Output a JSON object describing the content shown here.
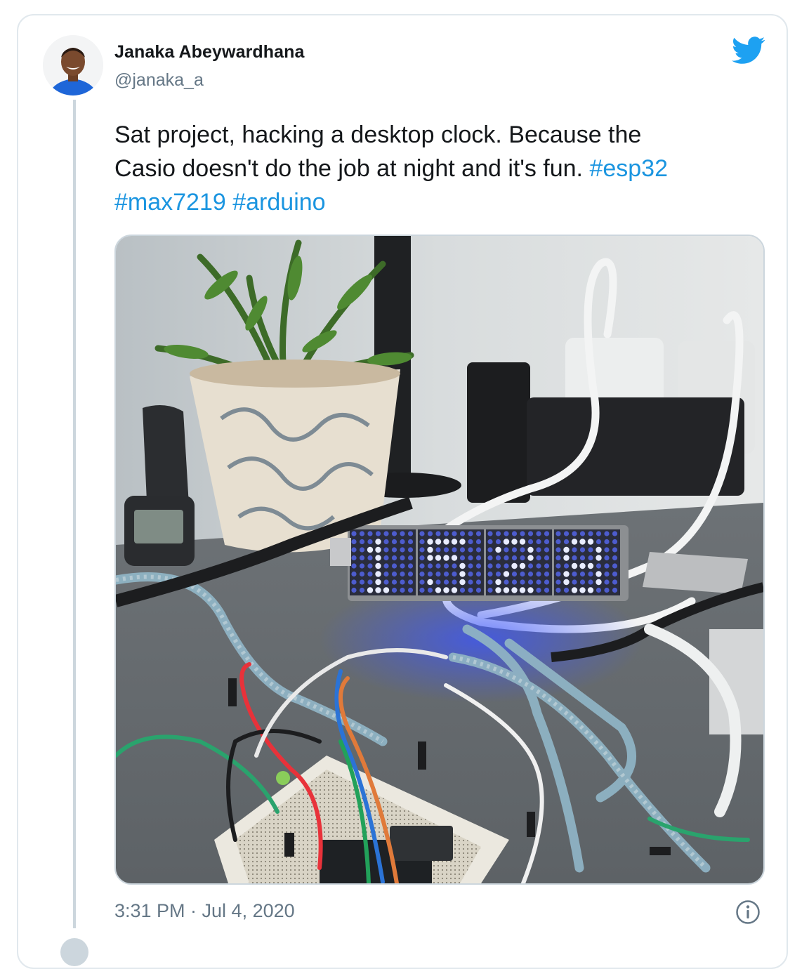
{
  "tweet": {
    "author_name": "Janaka Abeywardhana",
    "author_handle": "@janaka_a",
    "text_line1": "Sat project, hacking a desktop clock. Because the",
    "text_line2": "Casio doesn't do the job at night and it's fun. ",
    "hashtags": [
      "#esp32",
      "#max7219",
      "#arduino"
    ],
    "timestamp": "3:31 PM · Jul 4, 2020",
    "clock_display": "1528"
  },
  "icons": {
    "brand": "twitter-bird-icon",
    "info": "info-icon"
  },
  "colors": {
    "link": "#1b95e0",
    "twitter_blue": "#1da1f2",
    "secondary_text": "#657786",
    "border": "#e1e8ed"
  }
}
